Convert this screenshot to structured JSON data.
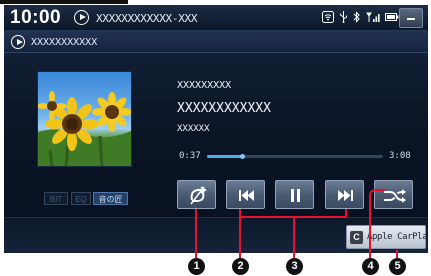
{
  "status_bar": {
    "time": "10:00",
    "now_playing": "XXXXXXXXXXXX-XXX",
    "icons": [
      "wifi-icon",
      "usb-icon",
      "bluetooth-icon",
      "signal-icon",
      "battery-icon"
    ],
    "menu_icon": "menu-icon"
  },
  "source_bar": {
    "title": "XXXXXXXXXXX"
  },
  "track": {
    "artist": "XXXXXXXXX",
    "title": "XXXXXXXXXXXX",
    "album": "XXXXXX",
    "elapsed": "0:37",
    "total": "3:08",
    "progress": 0.2
  },
  "audio_buttons": {
    "bit": "BIT",
    "eq": "EQ",
    "sound": "音の匠"
  },
  "controls": [
    "repeat-icon",
    "previous-icon",
    "pause-icon",
    "next-icon",
    "shuffle-icon"
  ],
  "carplay": {
    "badge": "C",
    "label": "Apple CarPlay"
  },
  "callouts": [
    "1",
    "2",
    "3",
    "4",
    "5"
  ],
  "colors": {
    "accent": "#4ab0f4",
    "callout": "#e8102a",
    "screen_bg": "#0a1424"
  }
}
